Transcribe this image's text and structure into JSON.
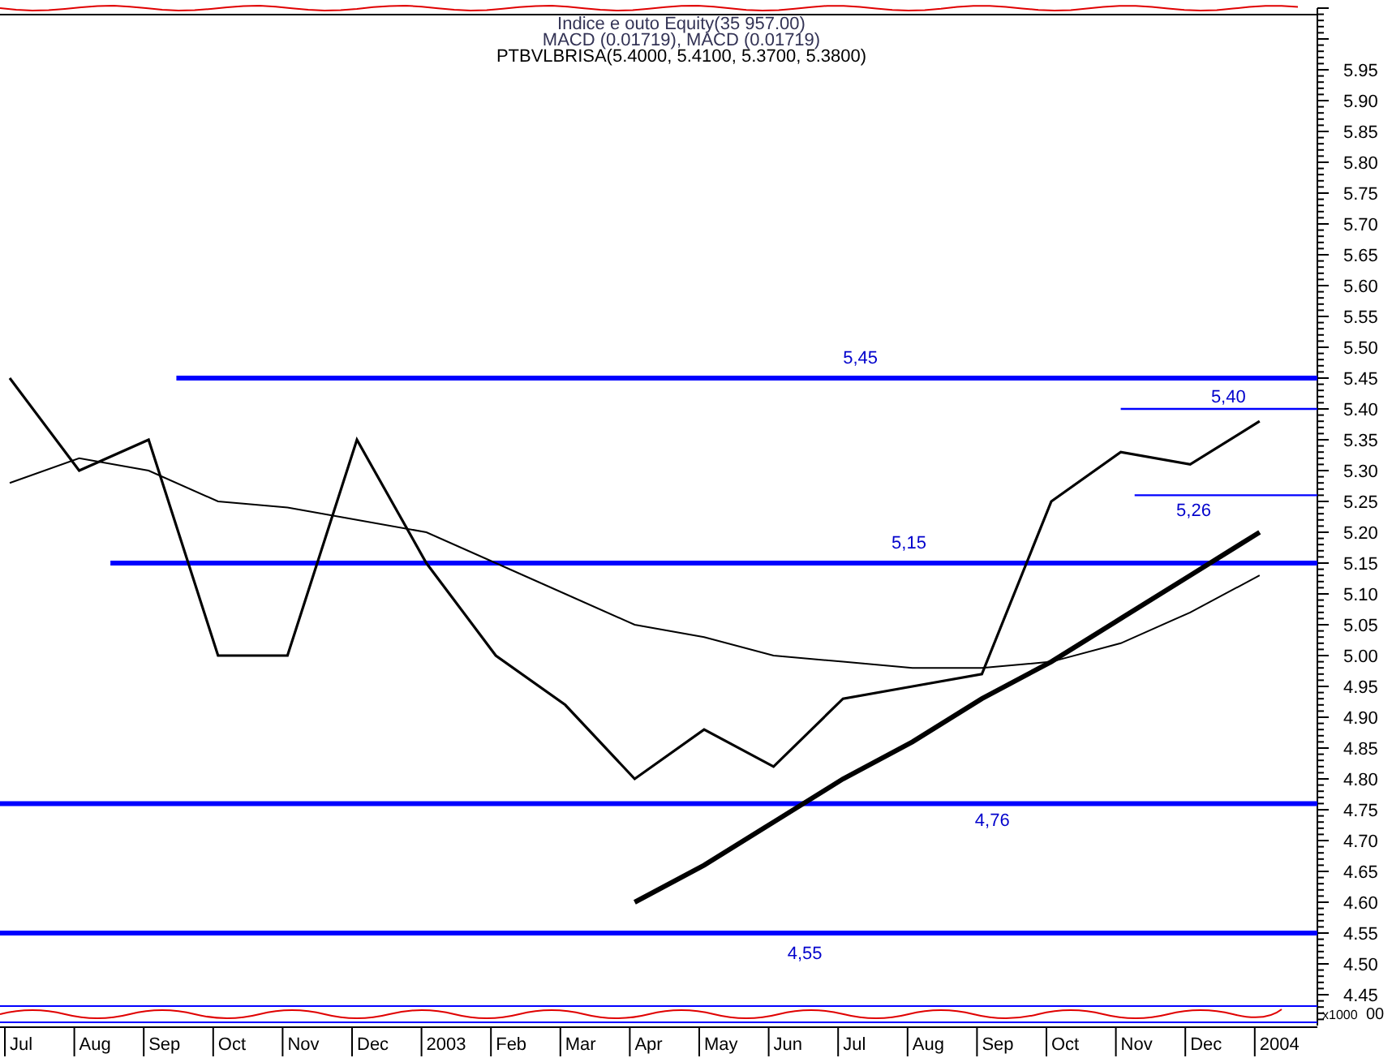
{
  "header": {
    "lines": [
      {
        "text": "Indice e outo Equity(35 957.00)",
        "kind": "faded"
      },
      {
        "text": "MACD (0.01719), MACD (0.01719)",
        "kind": "faded"
      },
      {
        "text": "PTBVLBRISA(5.4000, 5.4100, 5.3700, 5.3800)",
        "kind": "main"
      }
    ]
  },
  "price_chart": {
    "chart_data": {
      "type": "line",
      "categories": [
        "Jul",
        "Aug",
        "Sep",
        "Oct",
        "Nov",
        "Dec",
        "2003",
        "Feb",
        "Mar",
        "Apr",
        "May",
        "Jun",
        "Jul",
        "Aug",
        "Sep",
        "Oct",
        "Nov",
        "Dec",
        "2004"
      ],
      "series": [
        {
          "color": "#000000",
          "values": [
            5.45,
            5.3,
            5.35,
            5.0,
            5.0,
            5.35,
            5.15,
            5.0,
            4.92,
            4.8,
            4.88,
            4.82,
            4.93,
            4.95,
            4.97,
            5.25,
            5.33,
            5.31,
            5.38
          ]
        },
        {
          "color": "#000000",
          "values": [
            5.28,
            5.32,
            5.3,
            5.25,
            5.24,
            5.22,
            5.2,
            5.15,
            5.1,
            5.05,
            5.03,
            5.0,
            4.99,
            4.98,
            4.98,
            4.99,
            5.02,
            5.07,
            5.13
          ]
        },
        {
          "color": "#000000",
          "values": [
            null,
            null,
            null,
            null,
            null,
            null,
            null,
            null,
            null,
            4.6,
            4.66,
            4.73,
            4.8,
            4.86,
            4.93,
            4.99,
            5.06,
            5.13,
            5.2
          ]
        }
      ],
      "ylim": [
        4.4,
        6.05
      ],
      "yticks": [
        {
          "value": 5.95,
          "label": "5.95"
        },
        {
          "value": 5.9,
          "label": "5.90"
        },
        {
          "value": 5.85,
          "label": "5.85"
        },
        {
          "value": 5.8,
          "label": "5.80"
        },
        {
          "value": 5.75,
          "label": "5.75"
        },
        {
          "value": 5.7,
          "label": "5.70"
        },
        {
          "value": 5.65,
          "label": "5.65"
        },
        {
          "value": 5.6,
          "label": "5.60"
        },
        {
          "value": 5.55,
          "label": "5.55"
        },
        {
          "value": 5.5,
          "label": "5.50"
        },
        {
          "value": 5.45,
          "label": "5.45"
        },
        {
          "value": 5.4,
          "label": "5.40"
        },
        {
          "value": 5.35,
          "label": "5.35"
        },
        {
          "value": 5.3,
          "label": "5.30"
        },
        {
          "value": 5.25,
          "label": "5.25"
        },
        {
          "value": 5.2,
          "label": "5.20"
        },
        {
          "value": 5.15,
          "label": "5.15"
        },
        {
          "value": 5.1,
          "label": "5.10"
        },
        {
          "value": 5.05,
          "label": "5.05"
        },
        {
          "value": 5.0,
          "label": "5.00"
        },
        {
          "value": 4.95,
          "label": "4.95"
        },
        {
          "value": 4.9,
          "label": "4.90"
        },
        {
          "value": 4.85,
          "label": "4.85"
        },
        {
          "value": 4.8,
          "label": "4.80"
        },
        {
          "value": 4.75,
          "label": "4.75"
        },
        {
          "value": 4.7,
          "label": "4.70"
        },
        {
          "value": 4.65,
          "label": "4.65"
        },
        {
          "value": 4.6,
          "label": "4.60"
        },
        {
          "value": 4.55,
          "label": "4.55"
        },
        {
          "value": 4.5,
          "label": "4.50"
        },
        {
          "value": 4.45,
          "label": "4.45"
        }
      ],
      "ref_lines": [
        {
          "axis": "y",
          "value": 5.45,
          "label": "5,45"
        },
        {
          "axis": "y",
          "value": 5.4,
          "label": "5,40"
        },
        {
          "axis": "y",
          "value": 5.26,
          "label": "5,26"
        },
        {
          "axis": "y",
          "value": 5.15,
          "label": "5,15"
        },
        {
          "axis": "y",
          "value": 4.76,
          "label": "4,76"
        },
        {
          "axis": "y",
          "value": 4.55,
          "label": "4,55"
        }
      ]
    }
  },
  "lower_panel": {
    "scale_label": "x1000",
    "value_label": "00"
  }
}
